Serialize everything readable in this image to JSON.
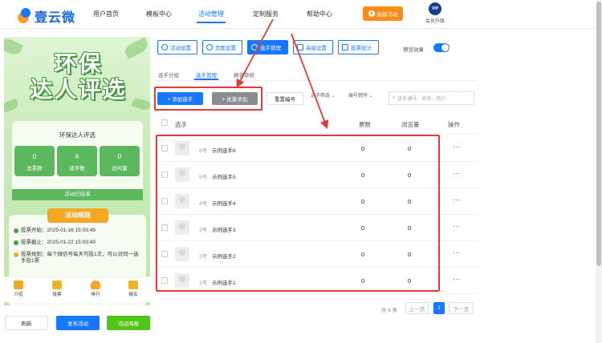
{
  "brand": {
    "name": "壹云微"
  },
  "nav": {
    "items": [
      "用户首页",
      "模板中心",
      "活动管理",
      "定制服务",
      "帮助中心"
    ],
    "create_label": "创建活动",
    "vip_badge": "VIP",
    "vip_label": "会员升级"
  },
  "preview": {
    "poster_title_line1": "环保",
    "poster_title_line2": "达人评选",
    "card_title": "环保达人评选",
    "stats": [
      {
        "value": "0",
        "label": "总票数"
      },
      {
        "value": "6",
        "label": "选手数"
      },
      {
        "value": "0",
        "label": "访问量"
      }
    ],
    "ended": "活动已结束",
    "rules_title": "活动规则",
    "rules": [
      "投票开始：2025-01-16 15:03:49",
      "投票截止：2025-01-22 15:03:49",
      "投票规则：每个微信号每天可投1次，可以对同一选手投1票"
    ],
    "tabs": [
      "介绍",
      "投票",
      "排行",
      "报名"
    ],
    "buttons": {
      "refresh": "刷新",
      "publish": "发布活动",
      "poster": "活动海报"
    }
  },
  "toolbar": {
    "buttons": [
      "活动设置",
      "页面设置",
      "选手管理",
      "高级设置",
      "投票统计"
    ],
    "active_index": 2,
    "preview_label": "预览效果",
    "preview_on": true
  },
  "subtabs": [
    "选手分组",
    "选手管理",
    "报名审核"
  ],
  "actions": {
    "add": "+ 添加选手",
    "batch_add": "+ 批量添加",
    "reset_no": "重置编号",
    "filter_status": "选手筛选",
    "sort_label": "编号倒序",
    "search_placeholder": "选手编号、名称、简介"
  },
  "table": {
    "headers": {
      "player": "选手",
      "votes": "票数",
      "views": "浏览量",
      "ops": "操作"
    },
    "rows": [
      {
        "no": "6号",
        "name": "示例选手6",
        "votes": "0",
        "views": "0",
        "more": "···"
      },
      {
        "no": "5号",
        "name": "示例选手5",
        "votes": "0",
        "views": "0",
        "more": "···"
      },
      {
        "no": "4号",
        "name": "示例选手4",
        "votes": "0",
        "views": "0",
        "more": "···"
      },
      {
        "no": "3号",
        "name": "示例选手3",
        "votes": "0",
        "views": "0",
        "more": "···"
      },
      {
        "no": "2号",
        "name": "示例选手2",
        "votes": "0",
        "views": "0",
        "more": "···"
      },
      {
        "no": "1号",
        "name": "示例选手1",
        "votes": "0",
        "views": "0",
        "more": "···"
      }
    ]
  },
  "pagination": {
    "total": "共 6 条",
    "prev": "上一页",
    "current": "1",
    "next": "下一页"
  },
  "colors": {
    "primary": "#1677ff",
    "orange": "#fa8c16",
    "green": "#5cb85c",
    "annotation": "#e53935"
  }
}
